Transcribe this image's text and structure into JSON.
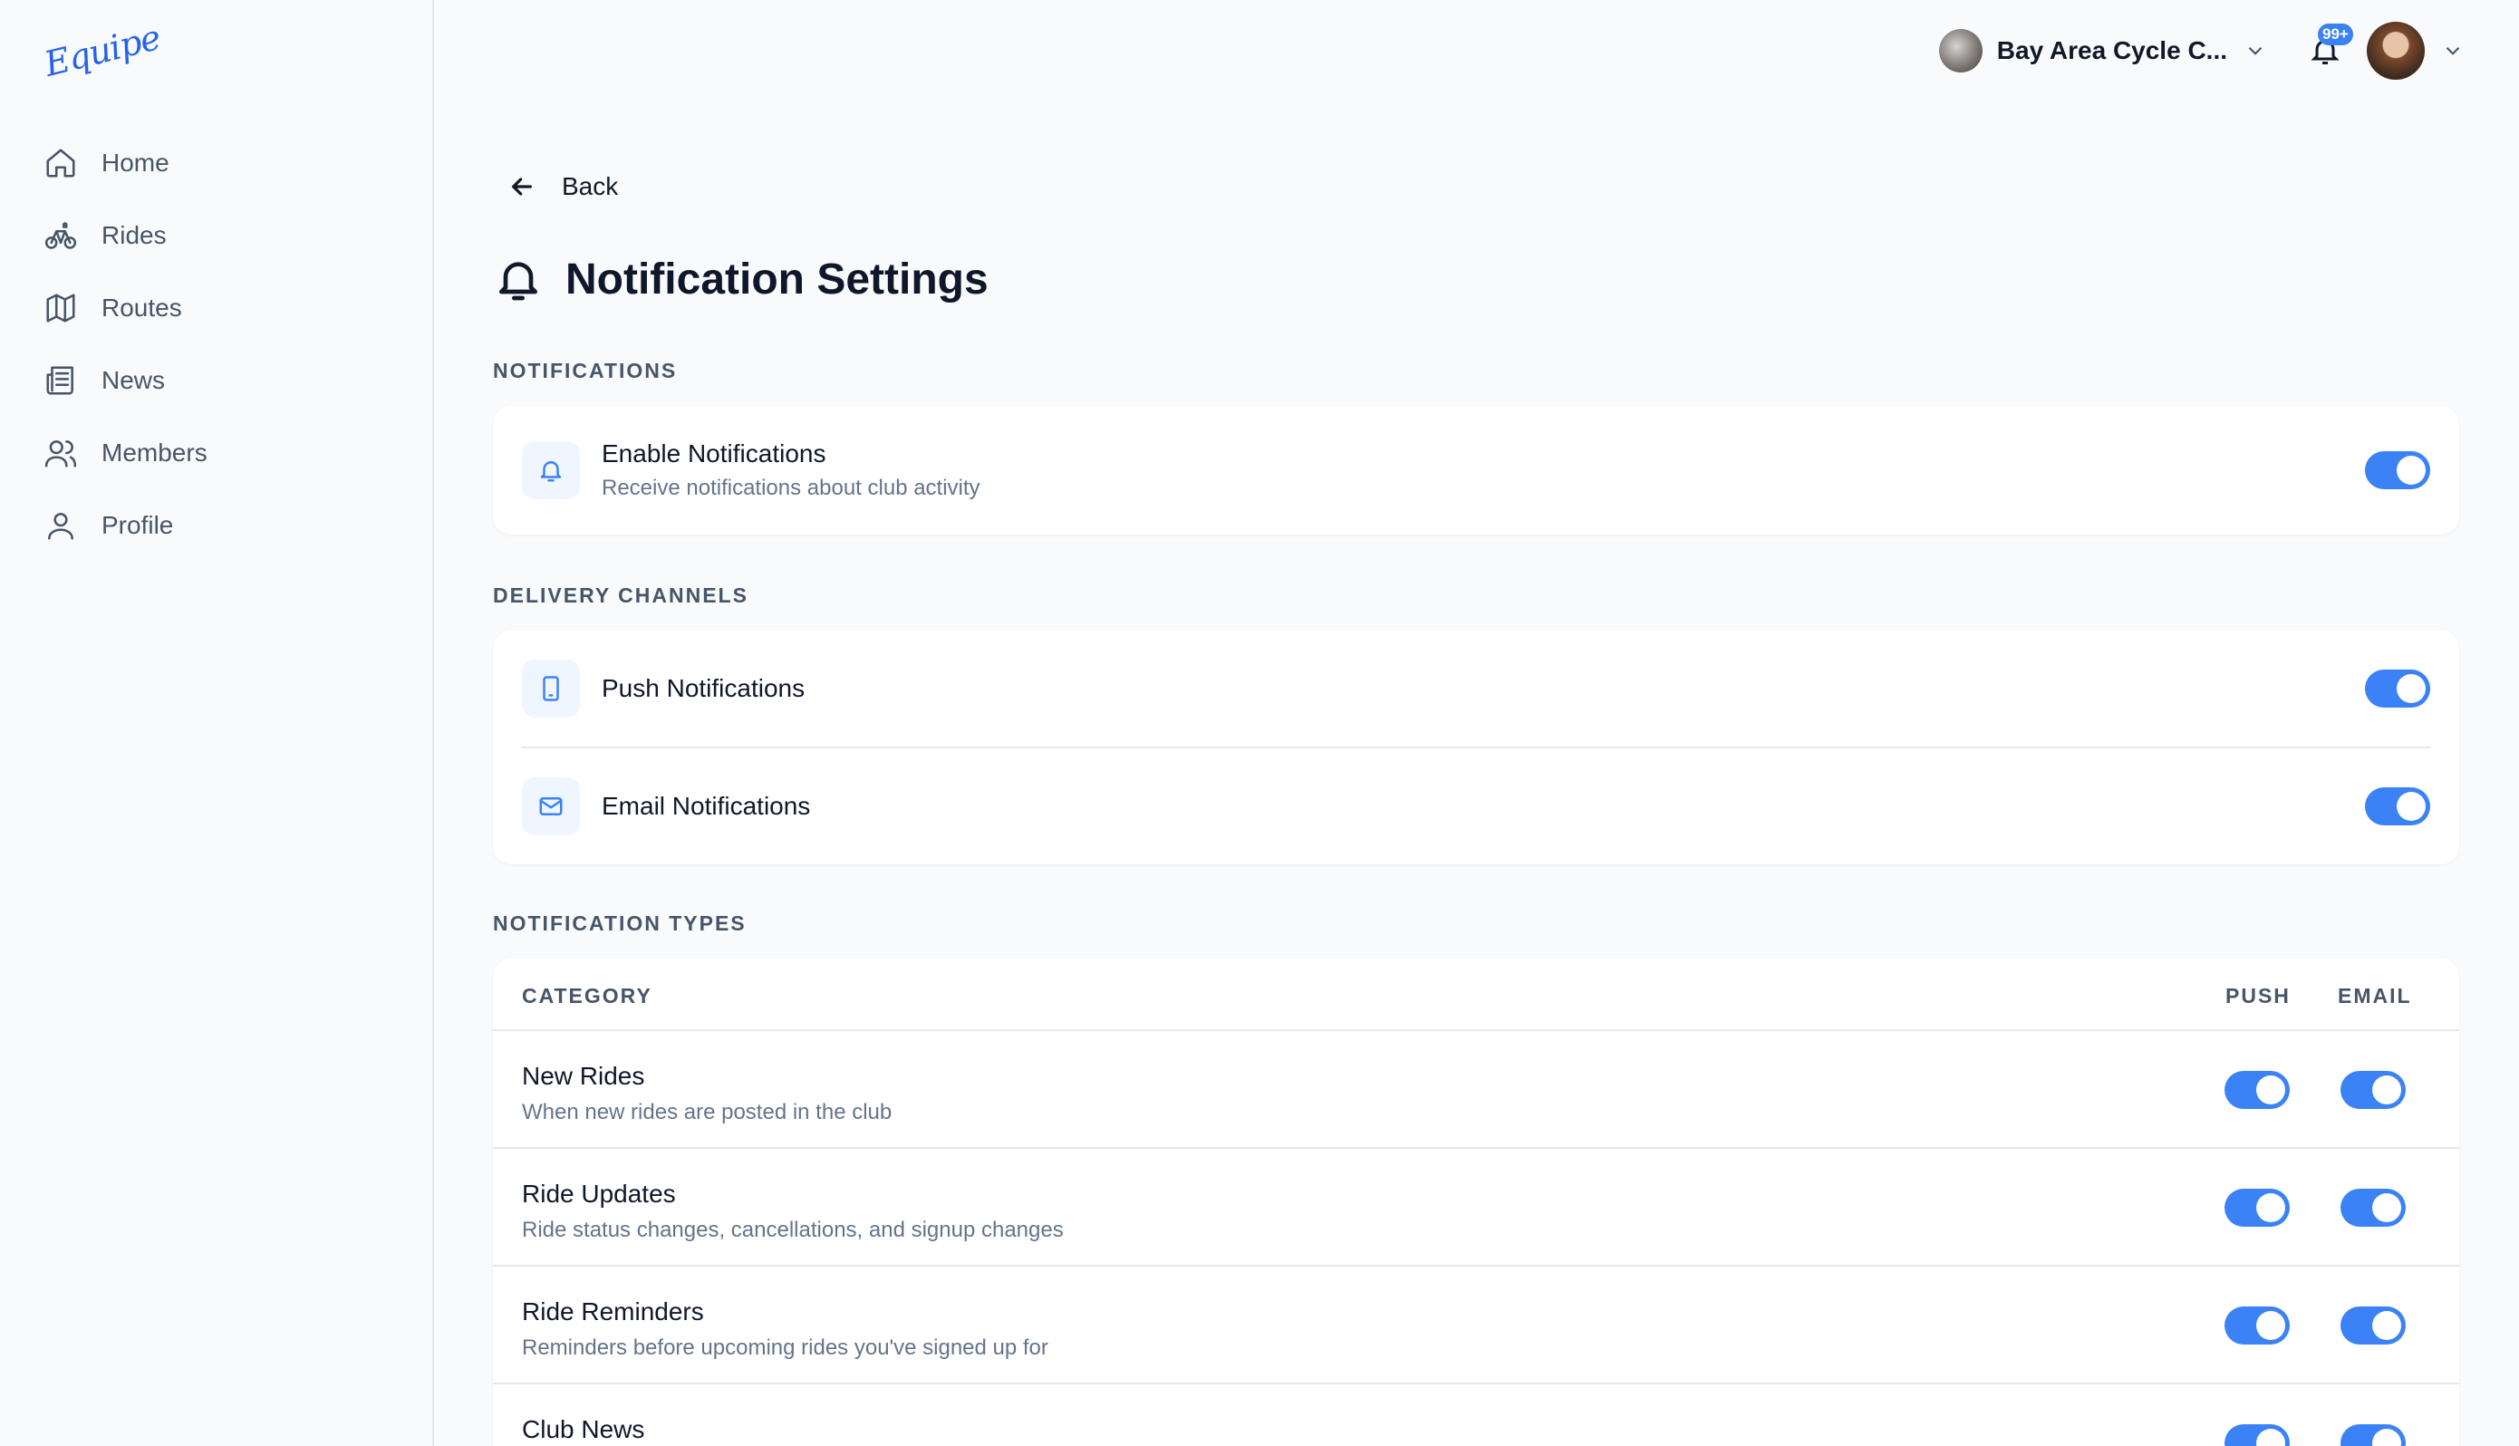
{
  "app": {
    "logo": "Equipe"
  },
  "sidebar": {
    "items": [
      {
        "label": "Home",
        "icon": "home-icon"
      },
      {
        "label": "Rides",
        "icon": "bike-icon"
      },
      {
        "label": "Routes",
        "icon": "map-icon"
      },
      {
        "label": "News",
        "icon": "newspaper-icon"
      },
      {
        "label": "Members",
        "icon": "users-icon"
      },
      {
        "label": "Profile",
        "icon": "user-icon"
      }
    ]
  },
  "header": {
    "club_name": "Bay Area Cycle C...",
    "notification_count": "99+"
  },
  "main": {
    "back_label": "Back",
    "title": "Notification Settings",
    "notifications": {
      "section_label": "NOTIFICATIONS",
      "enable": {
        "title": "Enable Notifications",
        "subtitle": "Receive notifications about club activity",
        "on": true
      }
    },
    "channels": {
      "section_label": "DELIVERY CHANNELS",
      "push": {
        "title": "Push Notifications",
        "on": true
      },
      "email": {
        "title": "Email Notifications",
        "on": true
      }
    },
    "types": {
      "section_label": "NOTIFICATION TYPES",
      "columns": {
        "category": "CATEGORY",
        "push": "PUSH",
        "email": "EMAIL"
      },
      "rows": [
        {
          "title": "New Rides",
          "subtitle": "When new rides are posted in the club",
          "push": true,
          "email": true
        },
        {
          "title": "Ride Updates",
          "subtitle": "Ride status changes, cancellations, and signup changes",
          "push": true,
          "email": true
        },
        {
          "title": "Ride Reminders",
          "subtitle": "Reminders before upcoming rides you've signed up for",
          "push": true,
          "email": true
        },
        {
          "title": "Club News",
          "subtitle": "",
          "push": true,
          "email": true
        }
      ]
    }
  },
  "colors": {
    "accent": "#3b82f6",
    "background": "#f8fafc",
    "card": "#ffffff"
  }
}
